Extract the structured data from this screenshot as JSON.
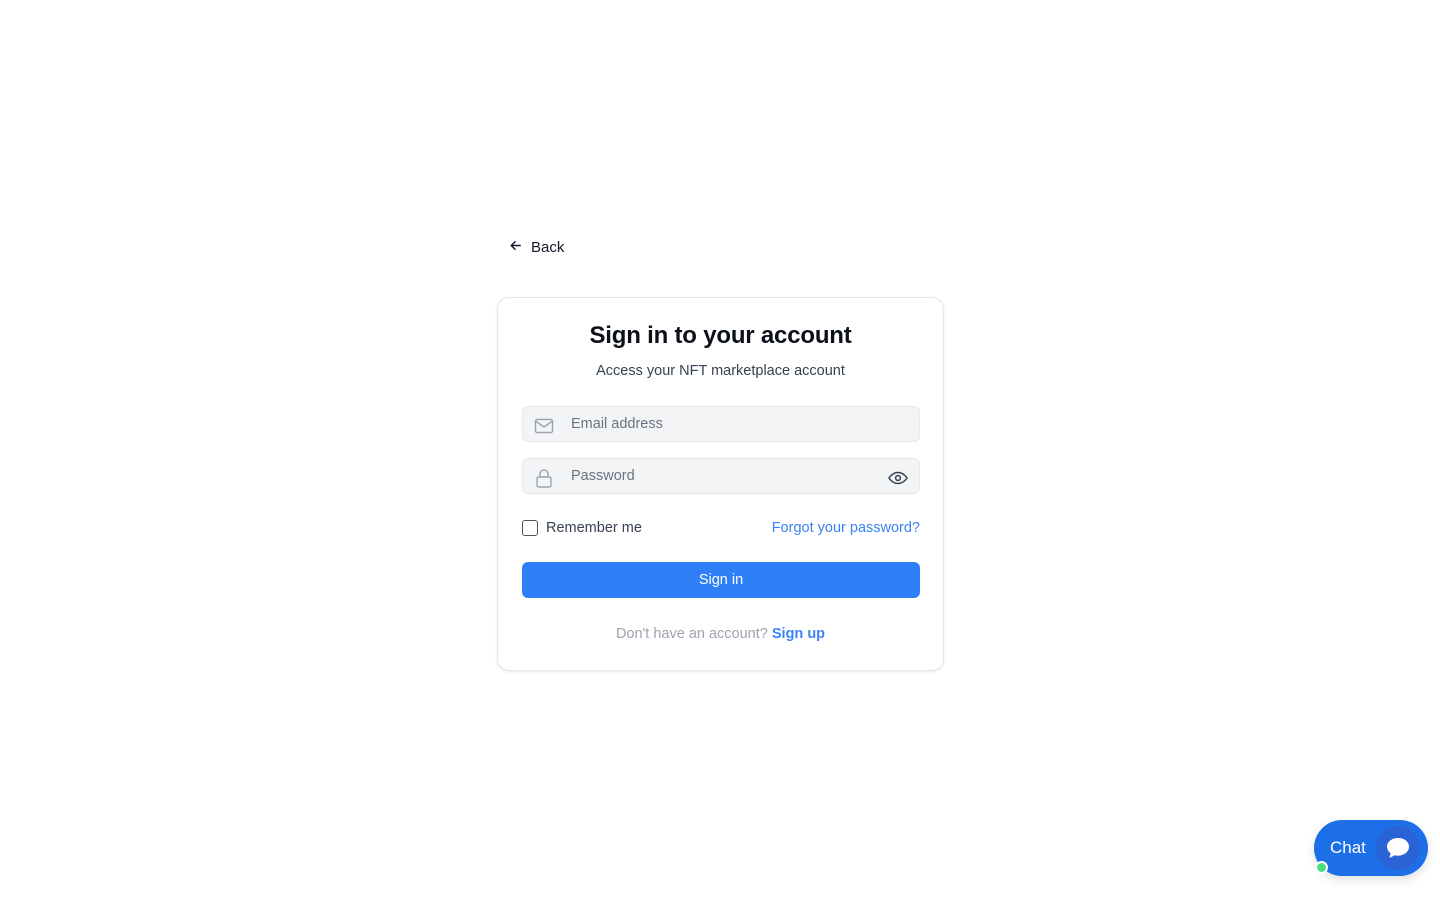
{
  "nav": {
    "back_label": "Back"
  },
  "card": {
    "title": "Sign in to your account",
    "subtitle": "Access your NFT marketplace account"
  },
  "form": {
    "email_placeholder": "Email address",
    "email_value": "",
    "password_placeholder": "Password",
    "password_value": "",
    "remember_label": "Remember me",
    "remember_checked": false,
    "forgot_label": "Forgot your password?",
    "submit_label": "Sign in"
  },
  "signup": {
    "prompt": "Don't have an account?",
    "link_label": "Sign up"
  },
  "chat": {
    "label": "Chat",
    "status": "online"
  },
  "icons": {
    "back": "arrow-left-icon",
    "email": "mail-icon",
    "password": "lock-icon",
    "toggle_password": "eye-icon",
    "chat": "chat-bubble-icon"
  },
  "colors": {
    "primary": "#2f80f7",
    "link": "#3b82f6",
    "chat_background": "#1d6fe8",
    "online": "#4ade80"
  }
}
